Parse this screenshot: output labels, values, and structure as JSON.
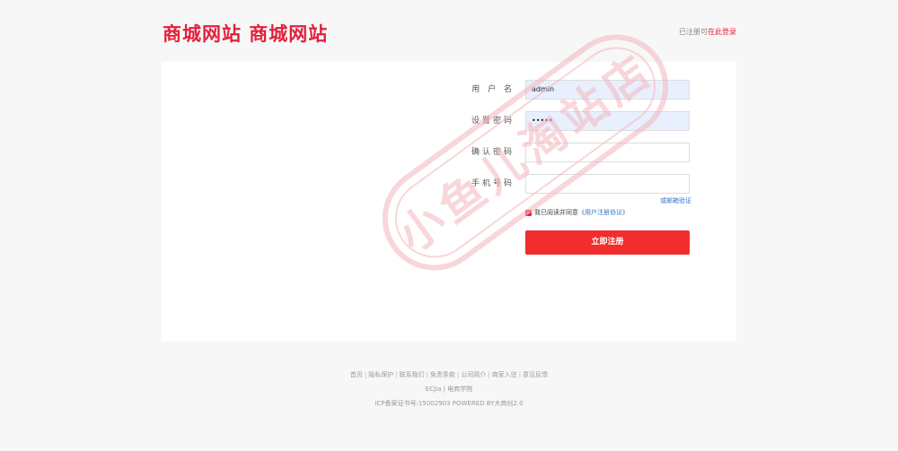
{
  "header": {
    "logo": "商城网站 商城网站",
    "login_hint_prefix": "已注册可",
    "login_link": "在此登录"
  },
  "form": {
    "username_label": "用 户 名",
    "username_value": "admin",
    "password_label": "设置密码",
    "password_value": "•••••",
    "confirm_label": "确认密码",
    "confirm_value": "",
    "phone_label": "手机号码",
    "phone_value": "",
    "alt_verify": "或邮箱验证",
    "agree_prefix": "我已阅读并同意",
    "agree_link": "《用户注册协议》",
    "submit_label": "立即注册"
  },
  "footer": {
    "links": [
      "首页",
      "隐私保护",
      "联系我们",
      "免责条款",
      "公司简介",
      "商家入驻",
      "意见反馈"
    ],
    "line2": "ECJia | 电商学院",
    "line3": "ICP备案证书号:15002903 POWERED BY大商创2.0"
  },
  "watermark": {
    "text": "小鱼儿淘站店",
    "color": "#f3b6bd"
  },
  "colors": {
    "brand": "#e4203c",
    "button": "#f22d2d",
    "link": "#3377cc"
  }
}
